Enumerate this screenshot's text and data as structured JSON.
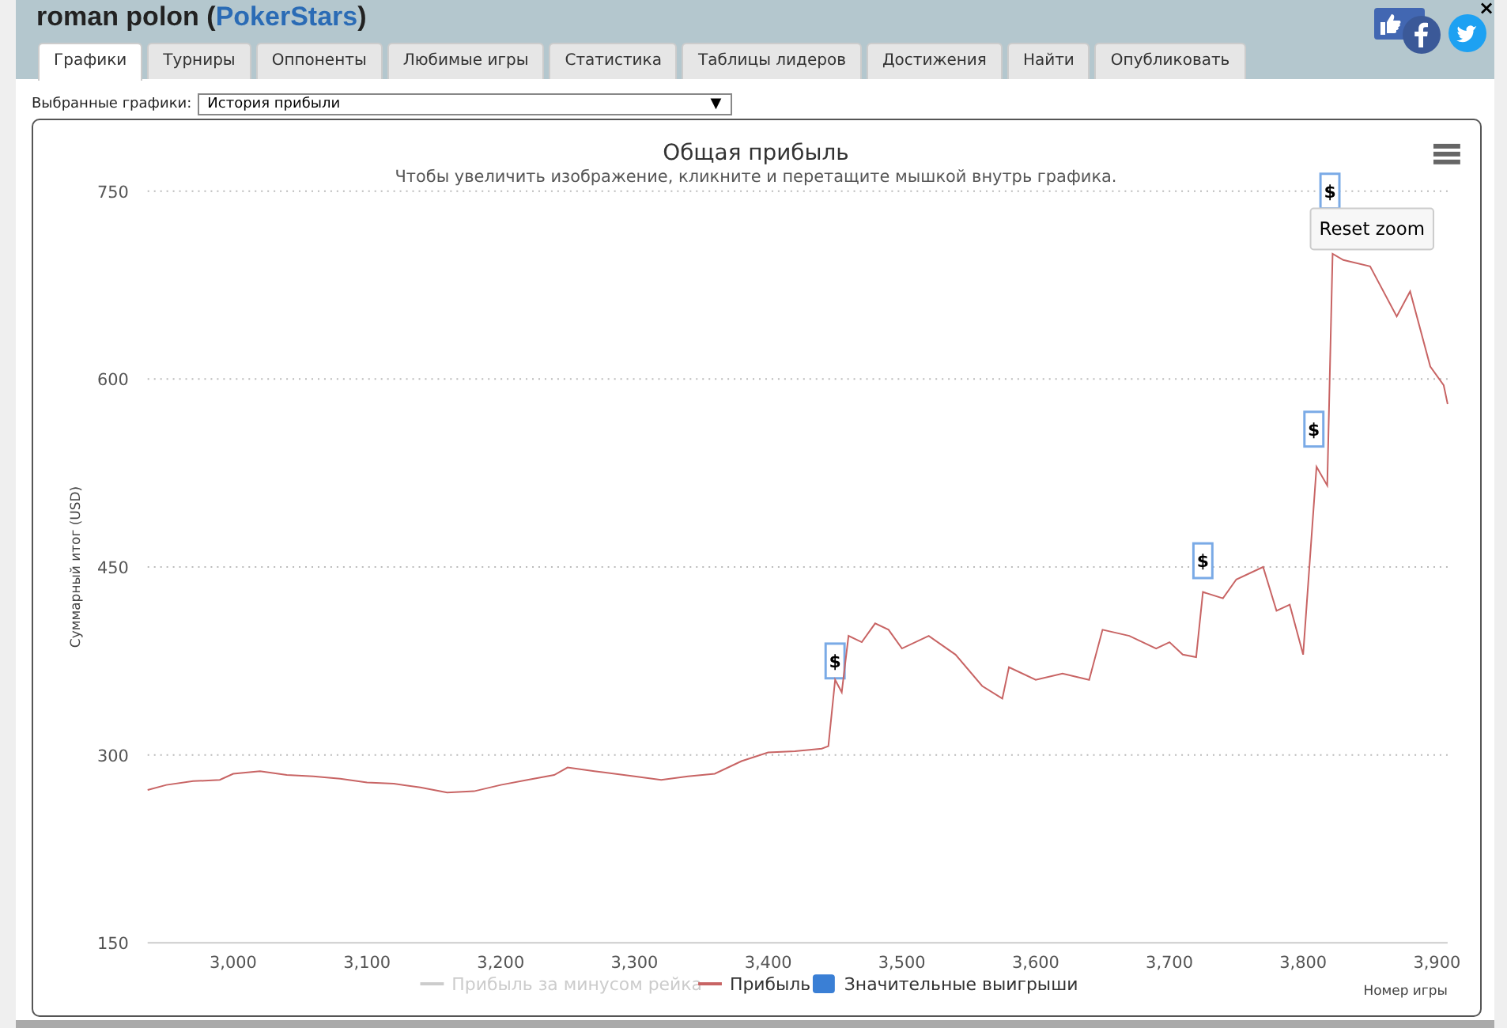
{
  "header": {
    "prefix": "roman polon (",
    "site": "PokerStars",
    "suffix": ")",
    "close": "×"
  },
  "tabs": [
    {
      "label": "Графики",
      "selected": true
    },
    {
      "label": "Турниры",
      "selected": false
    },
    {
      "label": "Оппоненты",
      "selected": false
    },
    {
      "label": "Любимые игры",
      "selected": false
    },
    {
      "label": "Статистика",
      "selected": false
    },
    {
      "label": "Таблицы лидеров",
      "selected": false
    },
    {
      "label": "Достижения",
      "selected": false
    },
    {
      "label": "Найти",
      "selected": false
    },
    {
      "label": "Опубликовать",
      "selected": false
    }
  ],
  "chart_select": {
    "label": "Выбранные графики:",
    "value": "История прибыли",
    "caret": "▼"
  },
  "chart": {
    "subtitle": "Чтобы увеличить изображение, кликните и перетащите мышкой внутрь графика.",
    "reset_button": "Reset zoom",
    "legend": [
      {
        "label": "Прибыль за минусом рейка",
        "kind": "line",
        "enabled": false
      },
      {
        "kind": "series",
        "enabled": true
      },
      {
        "label": "Значительные выигрыши",
        "kind": "box",
        "enabled": true,
        "color": "#3a7fd5"
      }
    ],
    "chart_data": {
      "type": "line",
      "title": "Общая прибыль",
      "xlabel": "Номер игры",
      "ylabel": "Суммарный итог (USD)",
      "xlim": [
        2936,
        3908
      ],
      "ylim": [
        150,
        750
      ],
      "grid": true,
      "xticks": [
        {
          "value": 3000,
          "label": "3,000"
        },
        {
          "value": 3100,
          "label": "3,100"
        },
        {
          "value": 3200,
          "label": "3,200"
        },
        {
          "value": 3300,
          "label": "3,300"
        },
        {
          "value": 3400,
          "label": "3,400"
        },
        {
          "value": 3500,
          "label": "3,500"
        },
        {
          "value": 3600,
          "label": "3,600"
        },
        {
          "value": 3700,
          "label": "3,700"
        },
        {
          "value": 3800,
          "label": "3,800"
        },
        {
          "value": 3900,
          "label": "3,900"
        }
      ],
      "yticks": [
        150,
        300,
        450,
        600,
        750
      ],
      "x": [
        2936,
        2950,
        2970,
        2990,
        3000,
        3020,
        3040,
        3060,
        3080,
        3100,
        3120,
        3140,
        3160,
        3180,
        3200,
        3220,
        3240,
        3250,
        3270,
        3300,
        3320,
        3340,
        3360,
        3380,
        3400,
        3420,
        3440,
        3445,
        3450,
        3455,
        3460,
        3470,
        3480,
        3490,
        3500,
        3520,
        3540,
        3560,
        3575,
        3580,
        3600,
        3620,
        3640,
        3650,
        3670,
        3690,
        3700,
        3710,
        3720,
        3725,
        3740,
        3750,
        3770,
        3780,
        3790,
        3800,
        3810,
        3818,
        3822,
        3830,
        3850,
        3870,
        3880,
        3895,
        3905,
        3908
      ],
      "series": [
        {
          "name": "Прибыль",
          "color": "#c86464",
          "values": [
            272,
            276,
            279,
            280,
            285,
            287,
            284,
            283,
            281,
            278,
            277,
            274,
            270,
            271,
            276,
            280,
            284,
            290,
            287,
            283,
            280,
            283,
            285,
            295,
            302,
            303,
            305,
            307,
            360,
            350,
            395,
            390,
            405,
            400,
            385,
            395,
            380,
            355,
            345,
            370,
            360,
            365,
            360,
            400,
            395,
            385,
            390,
            380,
            378,
            430,
            425,
            440,
            450,
            415,
            420,
            380,
            530,
            515,
            700,
            695,
            690,
            650,
            670,
            610,
            595,
            580
          ]
        }
      ],
      "annotations": [
        {
          "x": 3450,
          "y": 375,
          "text": "$"
        },
        {
          "x": 3725,
          "y": 455,
          "text": "$"
        },
        {
          "x": 3808,
          "y": 560,
          "text": "$"
        },
        {
          "x": 3820,
          "y": 750,
          "text": "$"
        }
      ]
    }
  }
}
